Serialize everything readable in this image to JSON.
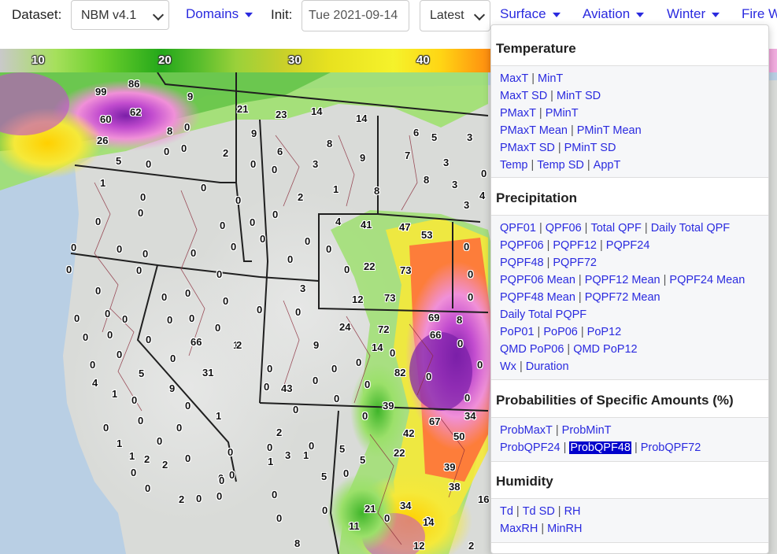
{
  "toolbar": {
    "dataset_label": "Dataset:",
    "dataset_value": "NBM v4.1",
    "domains_label": "Domains",
    "init_label": "Init:",
    "init_value": "Tue 2021-09-14",
    "run_value": "Latest",
    "menus": [
      "Surface",
      "Aviation",
      "Winter",
      "Fire W"
    ]
  },
  "colorbar": {
    "ticks": [
      "10",
      "20",
      "30",
      "40"
    ]
  },
  "map": {
    "station_values": [
      "86",
      "99",
      "62",
      "60",
      "9",
      "21",
      "23",
      "14",
      "14",
      "26",
      "8",
      "0",
      "9",
      "6",
      "5",
      "3",
      "0",
      "0",
      "2",
      "0",
      "6",
      "8",
      "3",
      "9",
      "7",
      "3",
      "5",
      "1",
      "0",
      "0",
      "0",
      "2",
      "0",
      "8",
      "8",
      "3",
      "1",
      "0",
      "0",
      "3",
      "4",
      "4",
      "41",
      "47",
      "53",
      "0",
      "0",
      "0",
      "0",
      "0",
      "0",
      "0",
      "0",
      "0",
      "0",
      "0",
      "0",
      "0",
      "0",
      "0",
      "22",
      "73",
      "0",
      "0",
      "0",
      "0",
      "0",
      "0",
      "0",
      "0",
      "3",
      "12",
      "73",
      "0",
      "0",
      "0",
      "0",
      "0",
      "0",
      "0",
      "0",
      "0",
      "0",
      "0",
      "0",
      "1",
      "0",
      "66",
      "69",
      "8",
      "24",
      "72",
      "66",
      "0",
      "0",
      "0",
      "0",
      "2",
      "9",
      "14",
      "0",
      "0",
      "5",
      "0",
      "31",
      "82",
      "0",
      "0",
      "4",
      "0",
      "0",
      "0",
      "9",
      "0",
      "0",
      "0",
      "1",
      "43",
      "39",
      "0",
      "0",
      "0",
      "1",
      "0",
      "0",
      "67",
      "34",
      "0",
      "0",
      "0",
      "42",
      "50",
      "0",
      "0",
      "2",
      "0",
      "22",
      "1",
      "0",
      "0",
      "1",
      "5",
      "5",
      "0",
      "1",
      "3",
      "1",
      "39",
      "2",
      "0",
      "0",
      "38",
      "2",
      "0",
      "0",
      "5",
      "16",
      "0",
      "2",
      "0",
      "0",
      "0",
      "21",
      "34",
      "0",
      "0",
      "0",
      "11",
      "14",
      "8",
      "12",
      "2"
    ]
  },
  "dropdown": {
    "sections": [
      {
        "title": "Temperature",
        "rows": [
          [
            "MaxT",
            "MinT"
          ],
          [
            "MaxT SD",
            "MinT SD"
          ],
          [
            "PMaxT",
            "PMinT"
          ],
          [
            "PMaxT Mean",
            "PMinT Mean"
          ],
          [
            "PMaxT SD",
            "PMinT SD"
          ],
          [
            "Temp",
            "Temp SD",
            "AppT"
          ]
        ]
      },
      {
        "title": "Precipitation",
        "rows": [
          [
            "QPF01",
            "QPF06",
            "Total QPF",
            "Daily Total QPF"
          ],
          [
            "PQPF06",
            "PQPF12",
            "PQPF24"
          ],
          [
            "PQPF48",
            "PQPF72"
          ],
          [
            "PQPF06 Mean",
            "PQPF12 Mean",
            "PQPF24 Mean"
          ],
          [
            "PQPF48 Mean",
            "PQPF72 Mean"
          ],
          [
            "Daily Total PQPF"
          ],
          [
            "PoP01",
            "PoP06",
            "PoP12"
          ],
          [
            "QMD PoP06",
            "QMD PoP12"
          ],
          [
            "Wx",
            "Duration"
          ]
        ]
      },
      {
        "title": "Probabilities of Specific Amounts (%)",
        "rows": [
          [
            "ProbMaxT",
            "ProbMinT"
          ],
          [
            "ProbQPF24",
            "ProbQPF48",
            "ProbQPF72"
          ]
        ]
      },
      {
        "title": "Humidity",
        "rows": [
          [
            "Td",
            "Td SD",
            "RH"
          ],
          [
            "MaxRH",
            "MinRH"
          ]
        ]
      }
    ],
    "selected": "ProbQPF48"
  },
  "colors": {
    "link": "#2a2adf",
    "selected_bg": "#0000cc"
  }
}
